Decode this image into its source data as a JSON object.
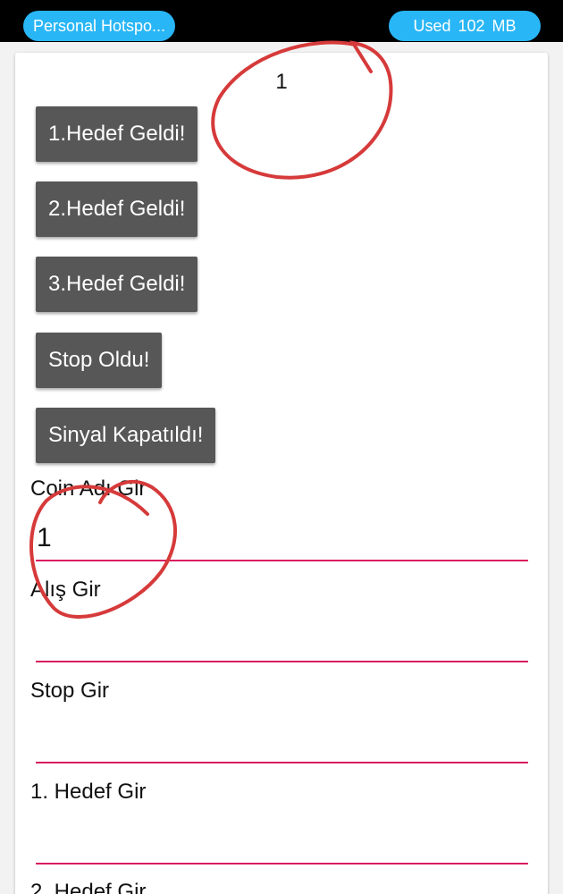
{
  "status_bar": {
    "hotspot_label": "Personal Hotspo...",
    "data_usage_label": "Used  102 MB"
  },
  "counter_value": "1",
  "buttons": [
    {
      "label": "1.Hedef Geldi!"
    },
    {
      "label": "2.Hedef Geldi!"
    },
    {
      "label": "3.Hedef Geldi!"
    },
    {
      "label": "Stop Oldu!"
    },
    {
      "label": "Sinyal Kapatıldı!"
    }
  ],
  "fields": [
    {
      "label": "Coin Adı Gir",
      "value": "1"
    },
    {
      "label": "Alış Gir",
      "value": ""
    },
    {
      "label": "Stop Gir",
      "value": ""
    },
    {
      "label": "1. Hedef Gir",
      "value": ""
    },
    {
      "label": "2. Hedef Gir",
      "value": ""
    }
  ],
  "colors": {
    "status_pill": "#29b6f6",
    "button_bg": "#575757",
    "field_underline": "#d81b60",
    "annotation": "#d63a3a"
  }
}
